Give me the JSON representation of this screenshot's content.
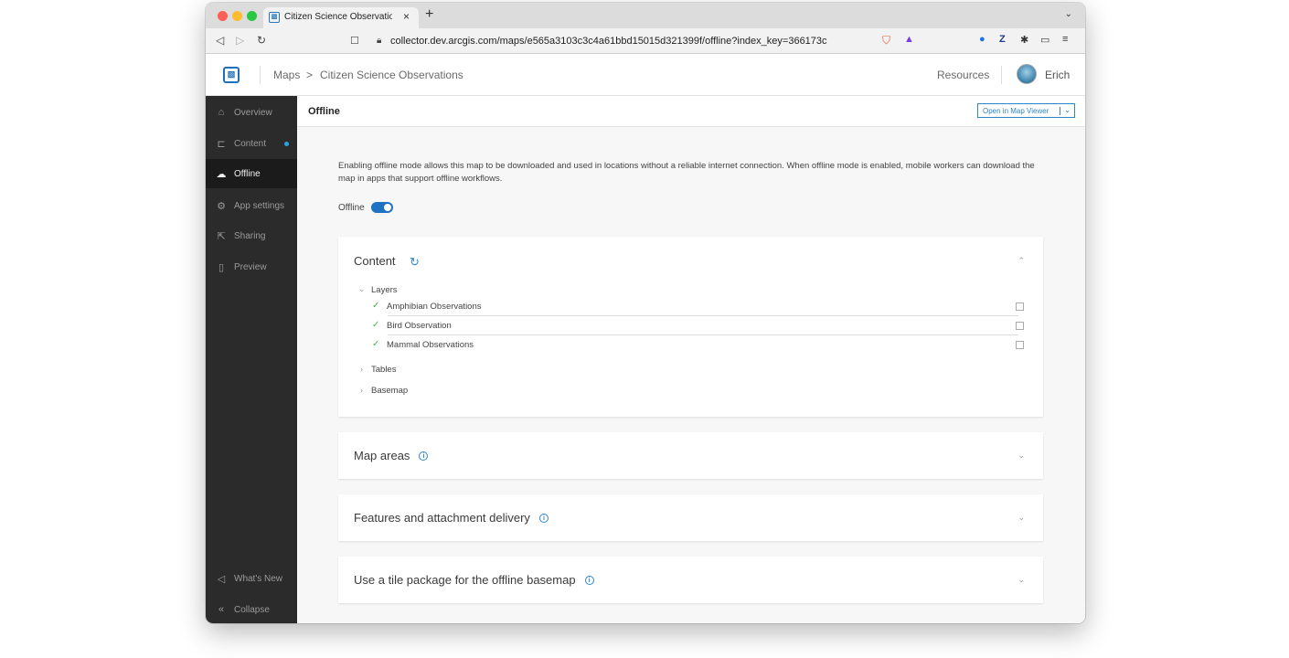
{
  "browser": {
    "tab_title": "Citizen Science Observations - ",
    "tab_favicon_icon": "arcgis-logo-icon",
    "url": "collector.dev.arcgis.com/maps/e565a3103c3c4a61bbd15015d321399f/offline?index_key=366173c",
    "traffic_colors": [
      "#fe5f57",
      "#febc2e",
      "#28c840"
    ]
  },
  "header": {
    "crumbs": [
      "Maps",
      ">",
      "Citizen Science Observations"
    ],
    "resources": "Resources",
    "user": "Erich"
  },
  "sidebar": {
    "items": [
      {
        "label": "Overview",
        "icon": "home-icon"
      },
      {
        "label": "Content",
        "icon": "tree-icon"
      },
      {
        "label": "Offline",
        "icon": "cloud-icon"
      },
      {
        "label": "App settings",
        "icon": "gear-icon"
      },
      {
        "label": "Sharing",
        "icon": "share-icon"
      },
      {
        "label": "Preview",
        "icon": "phone-icon"
      }
    ],
    "bottom": [
      {
        "label": "What's New",
        "icon": "megaphone-icon"
      },
      {
        "label": "Collapse",
        "icon": "collapse-icon"
      }
    ]
  },
  "main": {
    "title": "Offline",
    "open_viewer": "Open in Map Viewer",
    "description": "Enabling offline mode allows this map to be downloaded and used in locations without a reliable internet connection. When offline mode is enabled, mobile workers can download the map in apps that support offline workflows.",
    "offline_label": "Offline",
    "offline_enabled": true
  },
  "content_card": {
    "title": "Content",
    "layers_label": "Layers",
    "layers": [
      "Amphibian Observations",
      "Bird Observation",
      "Mammal Observations"
    ],
    "tables_label": "Tables",
    "basemap_label": "Basemap"
  },
  "cards": [
    {
      "title": "Map areas"
    },
    {
      "title": "Features and attachment delivery"
    },
    {
      "title": "Use a tile package for the offline basemap"
    }
  ]
}
